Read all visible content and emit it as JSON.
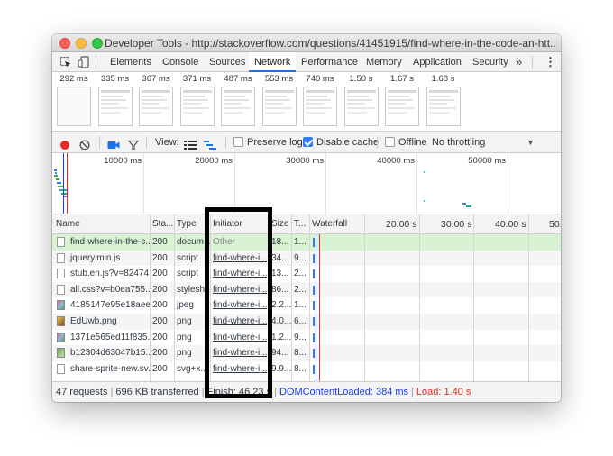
{
  "window": {
    "title": "Developer Tools - http://stackoverflow.com/questions/41451915/find-where-in-the-code-an-htt..."
  },
  "tabs": {
    "items": [
      {
        "label": "Elements"
      },
      {
        "label": "Console"
      },
      {
        "label": "Sources"
      },
      {
        "label": "Network"
      },
      {
        "label": "Performance"
      },
      {
        "label": "Memory"
      },
      {
        "label": "Application"
      },
      {
        "label": "Security"
      }
    ],
    "active": "Network",
    "more": "»",
    "menu": "⋮"
  },
  "filmstrip": {
    "frames": [
      {
        "time": "292 ms",
        "blank": true
      },
      {
        "time": "335 ms",
        "blank": false
      },
      {
        "time": "367 ms",
        "blank": false
      },
      {
        "time": "371 ms",
        "blank": false
      },
      {
        "time": "487 ms",
        "blank": false
      },
      {
        "time": "553 ms",
        "blank": false
      },
      {
        "time": "740 ms",
        "blank": false
      },
      {
        "time": "1.50 s",
        "blank": false
      },
      {
        "time": "1.67 s",
        "blank": false
      },
      {
        "time": "1.68 s",
        "blank": false
      }
    ]
  },
  "toolbar": {
    "view_label": "View:",
    "preserve_log": "Preserve log",
    "preserve_log_checked": false,
    "disable_cache": "Disable cache",
    "disable_cache_checked": true,
    "offline": "Offline",
    "offline_checked": false,
    "throttling": "No throttling"
  },
  "overview": {
    "ticks": [
      "10000 ms",
      "20000 ms",
      "30000 ms",
      "40000 ms",
      "50000 ms"
    ]
  },
  "grid": {
    "columns": {
      "name": "Name",
      "status": "Sta...",
      "type": "Type",
      "initiator": "Initiator",
      "size": "Size",
      "time": "T...",
      "waterfall": "Waterfall"
    },
    "waterfall_ticks": [
      "20.00 s",
      "30.00 s",
      "40.00 s",
      "50."
    ],
    "rows": [
      {
        "name": "find-where-in-the-c...",
        "status": "200",
        "type": "docum...",
        "initiator": "Other",
        "initiator_link": false,
        "size": "18...",
        "time": "1...",
        "icon": "doc",
        "selected": true
      },
      {
        "name": "jquery.min.js",
        "status": "200",
        "type": "script",
        "initiator": "find-where-i...",
        "initiator_link": true,
        "size": "34...",
        "time": "9...",
        "icon": "doc",
        "selected": false
      },
      {
        "name": "stub.en.js?v=82474...",
        "status": "200",
        "type": "script",
        "initiator": "find-where-i...",
        "initiator_link": true,
        "size": "13...",
        "time": "2...",
        "icon": "doc",
        "selected": false
      },
      {
        "name": "all.css?v=b0ea755...",
        "status": "200",
        "type": "stylesh...",
        "initiator": "find-where-i...",
        "initiator_link": true,
        "size": "86...",
        "time": "2...",
        "icon": "doc",
        "selected": false
      },
      {
        "name": "4185147e95e18aee...",
        "status": "200",
        "type": "jpeg",
        "initiator": "find-where-i...",
        "initiator_link": true,
        "size": "2.2...",
        "time": "1...",
        "icon": "img",
        "selected": false
      },
      {
        "name": "EdUwb.png",
        "status": "200",
        "type": "png",
        "initiator": "find-where-i...",
        "initiator_link": true,
        "size": "4.0...",
        "time": "6...",
        "icon": "img2",
        "selected": false
      },
      {
        "name": "1371e565ed11f835...",
        "status": "200",
        "type": "png",
        "initiator": "find-where-i...",
        "initiator_link": true,
        "size": "1.2...",
        "time": "9...",
        "icon": "img",
        "selected": false
      },
      {
        "name": "b12304d63047b15...",
        "status": "200",
        "type": "png",
        "initiator": "find-where-i...",
        "initiator_link": true,
        "size": "94...",
        "time": "8...",
        "icon": "img3",
        "selected": false
      },
      {
        "name": "share-sprite-new.sv...",
        "status": "200",
        "type": "svg+x...",
        "initiator": "find-where-i...",
        "initiator_link": true,
        "size": "9.9...",
        "time": "8...",
        "icon": "doc",
        "selected": false
      }
    ]
  },
  "status": {
    "requests": "47 requests",
    "transferred": "696 KB transferred",
    "finish": "Finish: 46.23 s",
    "dom": "DOMContentLoaded: 384 ms",
    "load": "Load: 1.40 s"
  },
  "colors": {
    "accent": "#1a73e8",
    "record": "#e52d27",
    "dom_blue": "#1a3ee0",
    "load_red": "#d93025",
    "selected_row": "#d8f2d2",
    "alt_row": "#f5f5f5",
    "link_row_hover": "#eef3fb"
  }
}
